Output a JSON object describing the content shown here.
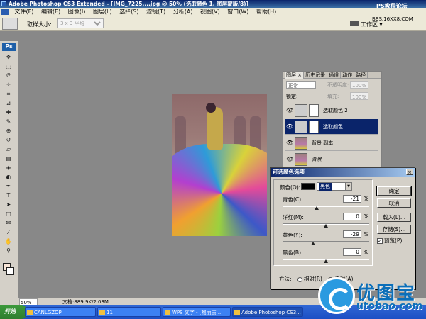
{
  "window": {
    "title": "Adobe Photoshop CS3 Extended - [IMG_7225....jpg @ 50% (选取颜色 1, 图层蒙版/8)]"
  },
  "menu": {
    "items": [
      "文件(F)",
      "编辑(E)",
      "图像(I)",
      "图层(L)",
      "选择(S)",
      "滤镜(T)",
      "分析(A)",
      "视图(V)",
      "窗口(W)",
      "帮助(H)"
    ]
  },
  "options": {
    "sample_label": "取样大小:",
    "sample_value": "3 x 3 平均",
    "workspace_label": "工作区 ▾"
  },
  "toolbox": {
    "logo": "Ps",
    "tools": [
      "move-icon",
      "marquee-icon",
      "lasso-icon",
      "magic-wand-icon",
      "crop-icon",
      "slice-icon",
      "healing-icon",
      "brush-icon",
      "stamp-icon",
      "history-brush-icon",
      "eraser-icon",
      "gradient-icon",
      "blur-icon",
      "dodge-icon",
      "pen-icon",
      "type-icon",
      "path-select-icon",
      "shape-icon",
      "notes-icon",
      "eyedropper-icon",
      "hand-icon",
      "zoom-icon"
    ],
    "tool_glyphs": [
      "✥",
      "⬚",
      "ᘓ",
      "✧",
      "⌗",
      "⊿",
      "✚",
      "✎",
      "⊕",
      "↺",
      "▱",
      "▤",
      "◈",
      "◐",
      "✒",
      "T",
      "➤",
      "□",
      "✉",
      "⁄",
      "✋",
      "⚲"
    ]
  },
  "layers_panel": {
    "tabs": [
      "图层 ×",
      "历史记录",
      "通道",
      "动作",
      "路径"
    ],
    "blend_mode": "正常",
    "opacity_label": "不透明度:",
    "opacity_value": "100%",
    "lock_label": "锁定:",
    "fill_label": "填充:",
    "fill_value": "100%",
    "layers": [
      {
        "name": "选取颜色 2",
        "selected": false
      },
      {
        "name": "选取颜色 1",
        "selected": true
      },
      {
        "name": "背景 副本",
        "selected": false
      },
      {
        "name": "背景",
        "selected": false
      }
    ]
  },
  "dialog": {
    "title": "可选颜色选项",
    "color_label": "颜色(O):",
    "color_value": "黑色",
    "sliders": [
      {
        "label": "青色(C):",
        "value": "-21",
        "unit": "%",
        "fraction": 0.395
      },
      {
        "label": "洋红(M):",
        "value": "0",
        "unit": "%",
        "fraction": 0.5
      },
      {
        "label": "黄色(Y):",
        "value": "-29",
        "unit": "%",
        "fraction": 0.355
      },
      {
        "label": "黑色(B):",
        "value": "0",
        "unit": "%",
        "fraction": 0.5
      }
    ],
    "ok": "确定",
    "cancel": "取消",
    "load": "载入(L)...",
    "save": "存储(S)...",
    "preview_label": "预览(P)",
    "preview_checked": true,
    "method_label": "方法:",
    "relative": "相对(R)",
    "absolute": "绝对(A)",
    "method_selected": "absolute"
  },
  "status": {
    "zoom": "50%",
    "doc": "文档:889.9K/2.03M"
  },
  "taskbar": {
    "start": "开始",
    "tasks": [
      "CANLGZOP",
      "11",
      "WPS 文字 - [袍丽质...",
      "Adobe Photoshop CS3..."
    ]
  },
  "watermark": {
    "title": "优图宝",
    "url": "utobao.com",
    "top": "PS教程论坛",
    "top2": "BBS.16XX8.COM"
  }
}
